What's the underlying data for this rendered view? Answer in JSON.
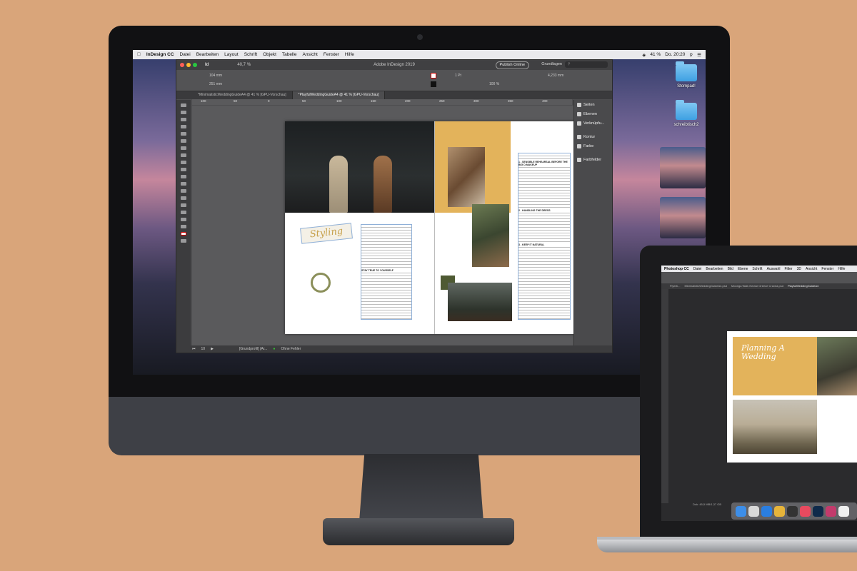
{
  "mac_menubar": {
    "app": "InDesign CC",
    "items": [
      "Datei",
      "Bearbeiten",
      "Layout",
      "Schrift",
      "Objekt",
      "Tabelle",
      "Ansicht",
      "Fenster",
      "Hilfe"
    ],
    "battery": "41 %",
    "clock": "Do. 20:20"
  },
  "indesign": {
    "window_title": "Adobe InDesign 2019",
    "zoom": "40,7 %",
    "publish_label": "Publish Online",
    "workspace": "Grundlagen",
    "control": {
      "x_value": "104 mm",
      "y_value": "251 mm",
      "stroke_weight": "1 Pt",
      "opacity": "100 %",
      "size_value": "4,233 mm"
    },
    "tabs": [
      {
        "label": "*MinimalisticWeddingGuideA4 @ 41 % [GPU-Vorschau]"
      },
      {
        "label": "*PlayfulWeddingGuideA4 @ 41 % [GPU-Vorschau]"
      }
    ],
    "ruler_ticks": [
      "100",
      "50",
      "0",
      "50",
      "100",
      "150",
      "200",
      "250",
      "300",
      "350",
      "400",
      "450"
    ],
    "panels": [
      {
        "label": "Seiten",
        "icon": "pages-icon"
      },
      {
        "label": "Ebenen",
        "icon": "layers-icon"
      },
      {
        "label": "Verknüpfu...",
        "icon": "links-icon"
      },
      {
        "label": "Kontur",
        "icon": "stroke-icon"
      },
      {
        "label": "Farbe",
        "icon": "color-icon"
      },
      {
        "label": "Farbfelder",
        "icon": "swatches-icon"
      }
    ],
    "status": {
      "page": "10",
      "master": "[Grundprofil] (Ar...",
      "preflight": "Ohne Fehler"
    }
  },
  "document": {
    "styling_word": "Styling",
    "headings": [
      "STAY TRUE TO YOURSELF",
      "1 - SENSIBLE REHEARSAL BEFORE THE BIG D-MAKEUP",
      "2 - HANDLING THE DRESS",
      "3 - KEEP IT NATURAL"
    ]
  },
  "desktop": {
    "folders": [
      {
        "label": "Stompad!",
        "icon": "folder-icon"
      },
      {
        "label": "schreibtisch2",
        "icon": "folder-icon"
      }
    ]
  },
  "photoshop": {
    "menubar": [
      "Photoshop CC",
      "Datei",
      "Bearbeiten",
      "Bild",
      "Ebene",
      "Schrift",
      "Auswahl",
      "Filter",
      "3D",
      "Ansicht",
      "Fenster",
      "Hilfe"
    ],
    "tabs": [
      "Flyerb...",
      "MinimalisticWeddingGuideA4.psd",
      "Moonga Walk Nectar Greece Cravea.psd",
      "PlayfulWeddingGuideA4"
    ],
    "poster_title": "Planning A Wedding",
    "status": "Dok: 45,5 MB/1,37 GB"
  },
  "colors": {
    "desk": "#d9a57a",
    "gold": "#e3b35b",
    "olive": "#4e5a33",
    "folder_blue": "#3ea0e2"
  }
}
